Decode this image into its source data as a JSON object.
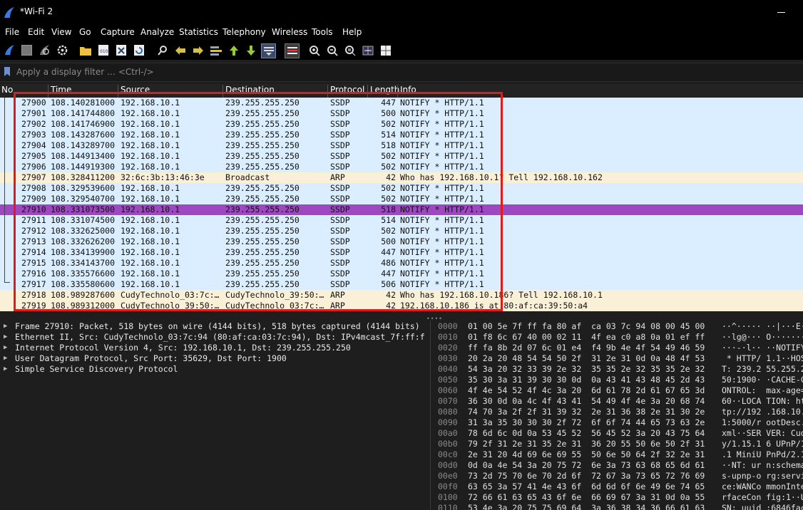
{
  "window": {
    "title": "*Wi-Fi 2"
  },
  "menu": [
    "File",
    "Edit",
    "View",
    "Go",
    "Capture",
    "Analyze",
    "Statistics",
    "Telephony",
    "Wireless",
    "Tools",
    "Help"
  ],
  "toolbar": [
    "start-capture",
    "stop-capture",
    "restart-capture",
    "capture-options",
    "open-file",
    "save-file",
    "close-file",
    "reload-file",
    "find-packet",
    "go-back",
    "go-forward",
    "go-to-packet",
    "go-first",
    "go-last",
    "auto-scroll",
    "colorize",
    "zoom-in",
    "zoom-out",
    "zoom-normal",
    "resize-columns",
    "layout"
  ],
  "filter": {
    "placeholder": "Apply a display filter … <Ctrl-/>"
  },
  "columns": [
    "No",
    "Time",
    "Source",
    "Destination",
    "Protocol",
    "Length",
    "Info"
  ],
  "colors": {
    "ssdp": "#daeeff",
    "arp": "#faf0d7",
    "selected": "#9e47c1",
    "highlight": "#e01b1b"
  },
  "packets": [
    {
      "no": "27900",
      "time": "108.140281000",
      "src": "192.168.10.1",
      "dst": "239.255.255.250",
      "proto": "SSDP",
      "len": "447",
      "info": "NOTIFY * HTTP/1.1",
      "type": "ssdp"
    },
    {
      "no": "27901",
      "time": "108.141744800",
      "src": "192.168.10.1",
      "dst": "239.255.255.250",
      "proto": "SSDP",
      "len": "500",
      "info": "NOTIFY * HTTP/1.1",
      "type": "ssdp"
    },
    {
      "no": "27902",
      "time": "108.141746900",
      "src": "192.168.10.1",
      "dst": "239.255.255.250",
      "proto": "SSDP",
      "len": "502",
      "info": "NOTIFY * HTTP/1.1",
      "type": "ssdp"
    },
    {
      "no": "27903",
      "time": "108.143287600",
      "src": "192.168.10.1",
      "dst": "239.255.255.250",
      "proto": "SSDP",
      "len": "514",
      "info": "NOTIFY * HTTP/1.1",
      "type": "ssdp"
    },
    {
      "no": "27904",
      "time": "108.143289700",
      "src": "192.168.10.1",
      "dst": "239.255.255.250",
      "proto": "SSDP",
      "len": "518",
      "info": "NOTIFY * HTTP/1.1",
      "type": "ssdp"
    },
    {
      "no": "27905",
      "time": "108.144913400",
      "src": "192.168.10.1",
      "dst": "239.255.255.250",
      "proto": "SSDP",
      "len": "502",
      "info": "NOTIFY * HTTP/1.1",
      "type": "ssdp"
    },
    {
      "no": "27906",
      "time": "108.144919300",
      "src": "192.168.10.1",
      "dst": "239.255.255.250",
      "proto": "SSDP",
      "len": "502",
      "info": "NOTIFY * HTTP/1.1",
      "type": "ssdp"
    },
    {
      "no": "27907",
      "time": "108.328411200",
      "src": "32:6c:3b:13:46:3e",
      "dst": "Broadcast",
      "proto": "ARP",
      "len": "42",
      "info": "Who has 192.168.10.1? Tell 192.168.10.162",
      "type": "arp"
    },
    {
      "no": "27908",
      "time": "108.329539600",
      "src": "192.168.10.1",
      "dst": "239.255.255.250",
      "proto": "SSDP",
      "len": "502",
      "info": "NOTIFY * HTTP/1.1",
      "type": "ssdp"
    },
    {
      "no": "27909",
      "time": "108.329540700",
      "src": "192.168.10.1",
      "dst": "239.255.255.250",
      "proto": "SSDP",
      "len": "502",
      "info": "NOTIFY * HTTP/1.1",
      "type": "ssdp"
    },
    {
      "no": "27910",
      "time": "108.331073500",
      "src": "192.168.10.1",
      "dst": "239.255.255.250",
      "proto": "SSDP",
      "len": "518",
      "info": "NOTIFY * HTTP/1.1",
      "type": "selected"
    },
    {
      "no": "27911",
      "time": "108.331074500",
      "src": "192.168.10.1",
      "dst": "239.255.255.250",
      "proto": "SSDP",
      "len": "514",
      "info": "NOTIFY * HTTP/1.1",
      "type": "ssdp"
    },
    {
      "no": "27912",
      "time": "108.332625000",
      "src": "192.168.10.1",
      "dst": "239.255.255.250",
      "proto": "SSDP",
      "len": "502",
      "info": "NOTIFY * HTTP/1.1",
      "type": "ssdp"
    },
    {
      "no": "27913",
      "time": "108.332626200",
      "src": "192.168.10.1",
      "dst": "239.255.255.250",
      "proto": "SSDP",
      "len": "500",
      "info": "NOTIFY * HTTP/1.1",
      "type": "ssdp"
    },
    {
      "no": "27914",
      "time": "108.334139900",
      "src": "192.168.10.1",
      "dst": "239.255.255.250",
      "proto": "SSDP",
      "len": "447",
      "info": "NOTIFY * HTTP/1.1",
      "type": "ssdp"
    },
    {
      "no": "27915",
      "time": "108.334143700",
      "src": "192.168.10.1",
      "dst": "239.255.255.250",
      "proto": "SSDP",
      "len": "486",
      "info": "NOTIFY * HTTP/1.1",
      "type": "ssdp"
    },
    {
      "no": "27916",
      "time": "108.335576600",
      "src": "192.168.10.1",
      "dst": "239.255.255.250",
      "proto": "SSDP",
      "len": "447",
      "info": "NOTIFY * HTTP/1.1",
      "type": "ssdp"
    },
    {
      "no": "27917",
      "time": "108.335580600",
      "src": "192.168.10.1",
      "dst": "239.255.255.250",
      "proto": "SSDP",
      "len": "506",
      "info": "NOTIFY * HTTP/1.1",
      "type": "ssdp"
    },
    {
      "no": "27918",
      "time": "108.989287600",
      "src": "CudyTechnolo_03:7c:…",
      "dst": "CudyTechnolo_39:50:…",
      "proto": "ARP",
      "len": "42",
      "info": "Who has 192.168.10.186? Tell 192.168.10.1",
      "type": "arp"
    },
    {
      "no": "27919",
      "time": "108.989312000",
      "src": "CudyTechnolo_39:50:…",
      "dst": "CudyTechnolo_03:7c:…",
      "proto": "ARP",
      "len": "42",
      "info": "192.168.10.186 is at 80:af:ca:39:50:a4",
      "type": "arp"
    }
  ],
  "details": [
    "Frame 27910: Packet, 518 bytes on wire (4144 bits), 518 bytes captured (4144 bits)",
    "Ethernet II, Src: CudyTechnolo_03:7c:94 (80:af:ca:03:7c:94), Dst: IPv4mcast_7f:ff:f",
    "Internet Protocol Version 4, Src: 192.168.10.1, Dst: 239.255.255.250",
    "User Datagram Protocol, Src Port: 35629, Dst Port: 1900",
    "Simple Service Discovery Protocol"
  ],
  "hex": [
    {
      "off": "0000",
      "hex": "01 00 5e 7f ff fa 80 af  ca 03 7c 94 08 00 45 00",
      "asc": "··^····· ··|···E·"
    },
    {
      "off": "0010",
      "hex": "01 f8 6c 67 40 00 02 11  4f ea c0 a8 0a 01 ef ff",
      "asc": "··lg@··· O·······"
    },
    {
      "off": "0020",
      "hex": "ff fa 8b 2d 07 6c 01 e4  f4 9b 4e 4f 54 49 46 59",
      "asc": "···-·l·· ··NOTIFY"
    },
    {
      "off": "0030",
      "hex": "20 2a 20 48 54 54 50 2f  31 2e 31 0d 0a 48 4f 53",
      "asc": " * HTTP/ 1.1··HOS"
    },
    {
      "off": "0040",
      "hex": "54 3a 20 32 33 39 2e 32  35 35 2e 32 35 35 2e 32",
      "asc": "T: 239.2 55.255.2"
    },
    {
      "off": "0050",
      "hex": "35 30 3a 31 39 30 30 0d  0a 43 41 43 48 45 2d 43",
      "asc": "50:1900· ·CACHE-C"
    },
    {
      "off": "0060",
      "hex": "4f 4e 54 52 4f 4c 3a 20  6d 61 78 2d 61 67 65 3d",
      "asc": "ONTROL:  max-age="
    },
    {
      "off": "0070",
      "hex": "36 30 0d 0a 4c 4f 43 41  54 49 4f 4e 3a 20 68 74",
      "asc": "60··LOCA TION: ht"
    },
    {
      "off": "0080",
      "hex": "74 70 3a 2f 2f 31 39 32  2e 31 36 38 2e 31 30 2e",
      "asc": "tp://192 .168.10."
    },
    {
      "off": "0090",
      "hex": "31 3a 35 30 30 30 2f 72  6f 6f 74 44 65 73 63 2e",
      "asc": "1:5000/r ootDesc."
    },
    {
      "off": "00a0",
      "hex": "78 6d 6c 0d 0a 53 45 52  56 45 52 3a 20 43 75 64",
      "asc": "xml··SER VER: Cud"
    },
    {
      "off": "00b0",
      "hex": "79 2f 31 2e 31 35 2e 31  36 20 55 50 6e 50 2f 31",
      "asc": "y/1.15.1 6 UPnP/1"
    },
    {
      "off": "00c0",
      "hex": "2e 31 20 4d 69 6e 69 55  50 6e 50 64 2f 32 2e 31",
      "asc": ".1 MiniU PnPd/2.1"
    },
    {
      "off": "00d0",
      "hex": "0d 0a 4e 54 3a 20 75 72  6e 3a 73 63 68 65 6d 61",
      "asc": "··NT: ur n:schema"
    },
    {
      "off": "00e0",
      "hex": "73 2d 75 70 6e 70 2d 6f  72 67 3a 73 65 72 76 69",
      "asc": "s-upnp-o rg:servi"
    },
    {
      "off": "00f0",
      "hex": "63 65 3a 57 41 4e 43 6f  6d 6d 6f 6e 49 6e 74 65",
      "asc": "ce:WANCo mmonInte"
    },
    {
      "off": "0100",
      "hex": "72 66 61 63 65 43 6f 6e  66 69 67 3a 31 0d 0a 55",
      "asc": "rfaceCon fig:1··U"
    },
    {
      "off": "0110",
      "hex": "53 4e 3a 20 75 75 69 64  3a 36 38 34 36 66 61 63",
      "asc": "SN: uuid :6846fac"
    }
  ]
}
